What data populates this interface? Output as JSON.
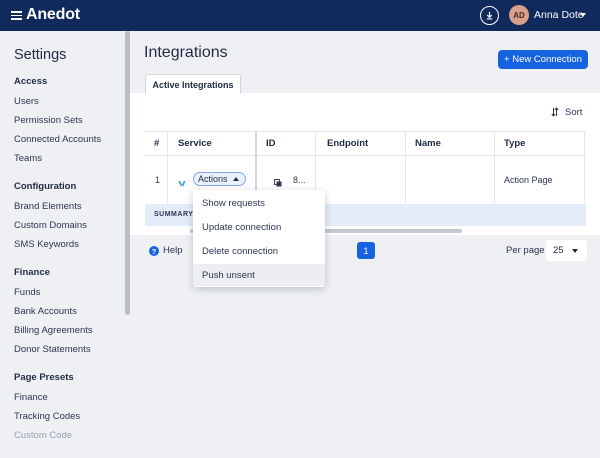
{
  "topbar": {
    "logo": "Anedot",
    "user_initials": "AD",
    "user_name": "Anna Dote",
    "icons": [
      "menu-icon",
      "download-icon",
      "caret-down-icon"
    ]
  },
  "sidebar": {
    "title": "Settings",
    "sections": [
      {
        "heading": "Access",
        "items": [
          "Users",
          "Permission Sets",
          "Connected Accounts",
          "Teams"
        ]
      },
      {
        "heading": "Configuration",
        "items": [
          "Brand Elements",
          "Custom Domains",
          "SMS Keywords"
        ]
      },
      {
        "heading": "Finance",
        "items": [
          "Funds",
          "Bank Accounts",
          "Billing Agreements",
          "Donor Statements"
        ]
      },
      {
        "heading": "Page Presets",
        "items": [
          "Finance",
          "Tracking Codes",
          "Custom Code"
        ]
      }
    ]
  },
  "main": {
    "title": "Integrations",
    "new_button": "+ New Connection",
    "tab": "Active Integrations",
    "sort_label": "Sort",
    "table": {
      "columns": [
        "#",
        "Service",
        "ID",
        "Endpoint",
        "Name",
        "Type"
      ],
      "rows": [
        {
          "num": "1",
          "actions_label": "Actions",
          "id": "8...",
          "endpoint": "",
          "name": "",
          "type": "Action Page"
        }
      ],
      "summary": "SUMMARY"
    },
    "menu": [
      "Show requests",
      "Update connection",
      "Delete connection",
      "Push unsent"
    ],
    "help_label": "Help",
    "page": "1",
    "per_page_label": "Per page",
    "per_page_value": "25"
  },
  "colors": {
    "nav": "#102a5c",
    "accent": "#1663e0",
    "summary": "#e4ecfa"
  }
}
